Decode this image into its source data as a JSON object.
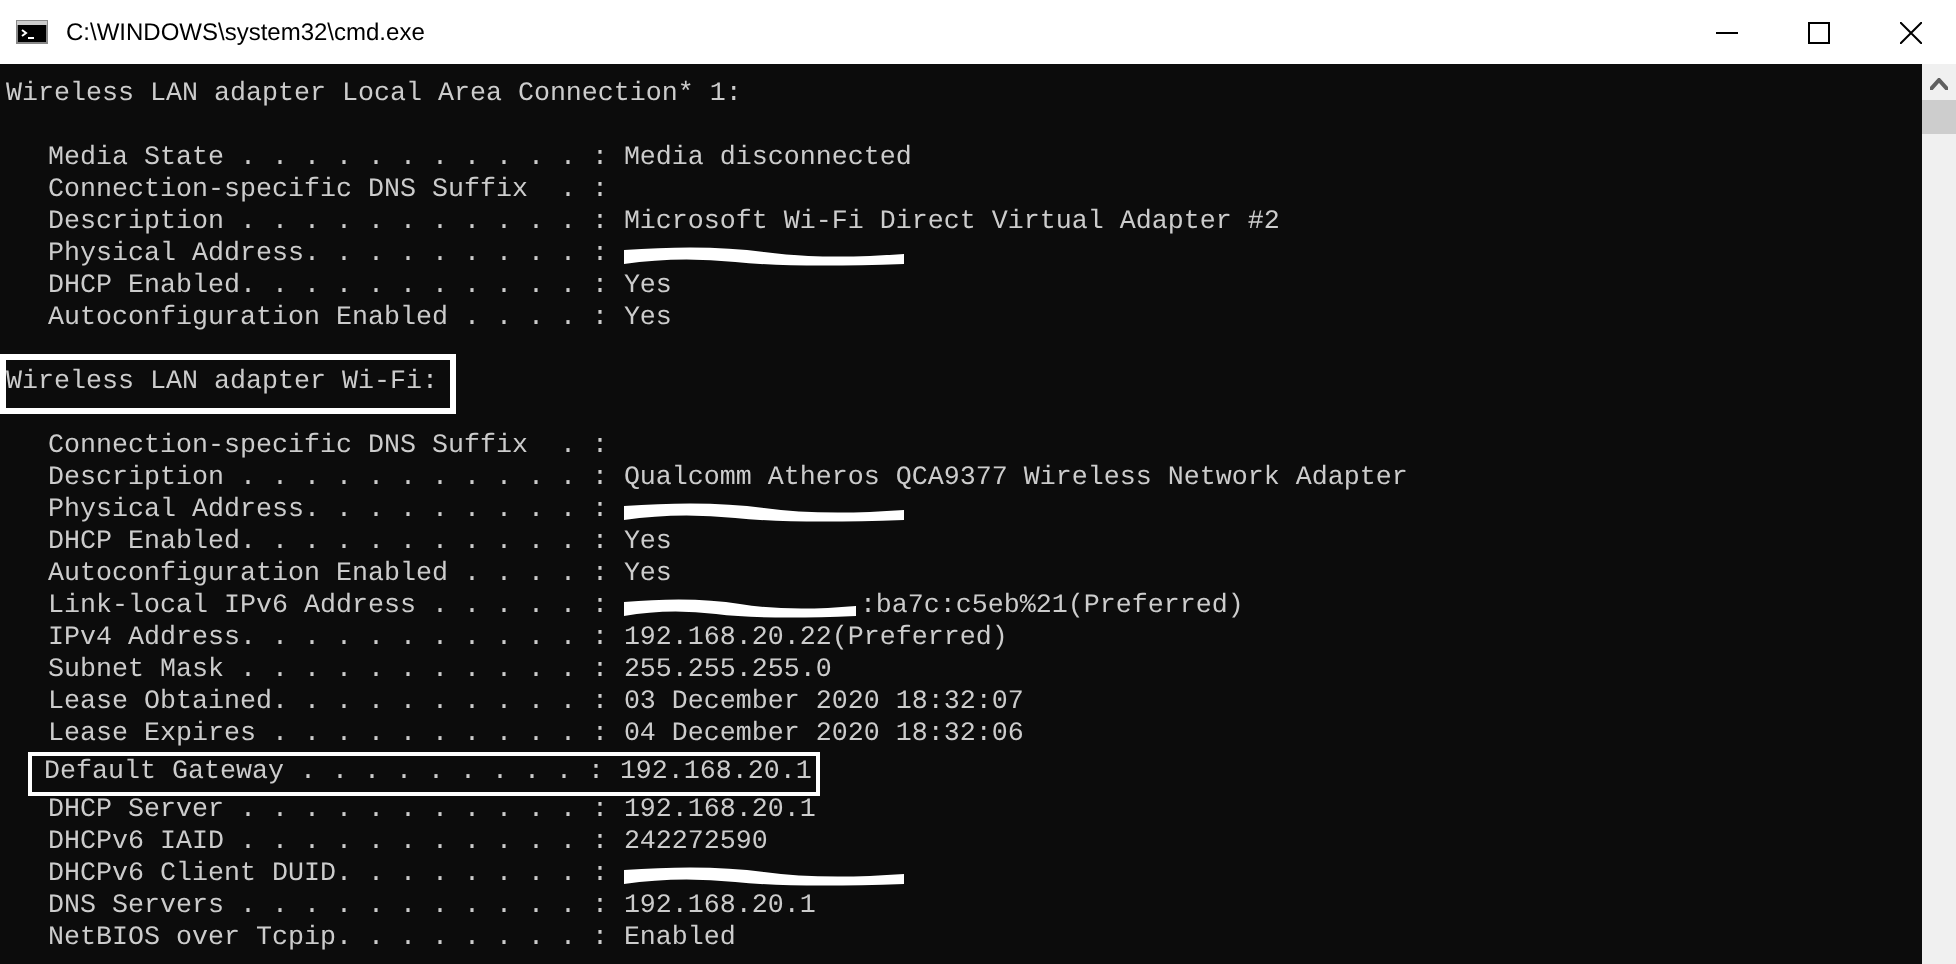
{
  "window": {
    "title": "C:\\WINDOWS\\system32\\cmd.exe"
  },
  "sections": [
    {
      "heading": "Wireless LAN adapter Local Area Connection* 1:",
      "highlighted": false,
      "entries": [
        {
          "label": "Media State . . . . . . . . . . . :",
          "value": "Media disconnected",
          "highlighted": false
        },
        {
          "label": "Connection-specific DNS Suffix  . :",
          "highlighted": false
        },
        {
          "label": "Description . . . . . . . . . . . :",
          "value": "Microsoft Wi-Fi Direct Virtual Adapter #2",
          "highlighted": false
        },
        {
          "label": "Physical Address. . . . . . . . . :",
          "redacted": true,
          "highlighted": false
        },
        {
          "label": "DHCP Enabled. . . . . . . . . . . :",
          "value": "Yes",
          "highlighted": false
        },
        {
          "label": "Autoconfiguration Enabled . . . . :",
          "value": "Yes",
          "highlighted": false
        }
      ]
    },
    {
      "heading": "Wireless LAN adapter Wi-Fi:",
      "highlighted": true,
      "entries": [
        {
          "label": "Connection-specific DNS Suffix  . :",
          "highlighted": false
        },
        {
          "label": "Description . . . . . . . . . . . :",
          "value": "Qualcomm Atheros QCA9377 Wireless Network Adapter",
          "highlighted": false
        },
        {
          "label": "Physical Address. . . . . . . . . :",
          "redacted": true,
          "highlighted": false
        },
        {
          "label": "DHCP Enabled. . . . . . . . . . . :",
          "value": "Yes",
          "highlighted": false
        },
        {
          "label": "Autoconfiguration Enabled . . . . :",
          "value": "Yes",
          "highlighted": false
        },
        {
          "label": "Link-local IPv6 Address . . . . . :",
          "redacted": true,
          "value": ":ba7c:c5eb%21(Preferred)",
          "highlighted": false
        },
        {
          "label": "IPv4 Address. . . . . . . . . . . :",
          "value": "192.168.20.22(Preferred)",
          "highlighted": false
        },
        {
          "label": "Subnet Mask . . . . . . . . . . . :",
          "value": "255.255.255.0",
          "highlighted": false
        },
        {
          "label": "Lease Obtained. . . . . . . . . . :",
          "value": "03 December 2020 18:32:07",
          "highlighted": false
        },
        {
          "label": "Lease Expires . . . . . . . . . . :",
          "value": "04 December 2020 18:32:06",
          "highlighted": false
        },
        {
          "label": "Default Gateway . . . . . . . . . :",
          "value": "192.168.20.1",
          "highlighted": true
        },
        {
          "label": "DHCP Server . . . . . . . . . . . :",
          "value": "192.168.20.1",
          "highlighted": false
        },
        {
          "label": "DHCPv6 IAID . . . . . . . . . . . :",
          "value": "242272590",
          "highlighted": false
        },
        {
          "label": "DHCPv6 Client DUID. . . . . . . . :",
          "redacted": true,
          "highlighted": false
        },
        {
          "label": "DNS Servers . . . . . . . . . . . :",
          "value": "192.168.20.1",
          "highlighted": false
        },
        {
          "label": "NetBIOS over Tcpip. . . . . . . . :",
          "value": "Enabled",
          "highlighted": false
        }
      ]
    }
  ]
}
